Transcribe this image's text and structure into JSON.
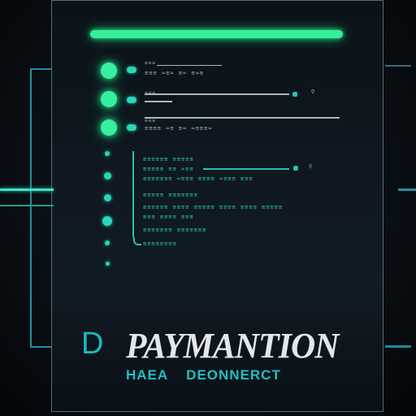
{
  "screen": {
    "title_prefix": "D",
    "title": "PAYMANTION",
    "subtitle_left": "HAEA",
    "subtitle_right": "DEONNERCT"
  },
  "colors": {
    "accent_green": "#35ef9a",
    "accent_teal": "#2bbfb0",
    "title_text": "#e3e7e9",
    "subtitle_text": "#1fc0c4",
    "background": "#0a1116"
  },
  "rows": {
    "row1": {
      "text_a": "≡≡≡ ≈≡≈ ≡≈ ≡≈≡",
      "text_b": "≡≡≡"
    },
    "row2": {
      "text_a": "≡≡≡",
      "marker": "ǫ"
    },
    "row3": {
      "text_a": "≡≡≡≡ ≈≡ ≡≈ ≈≡≡≡≈",
      "text_b": "≡≡≡"
    }
  },
  "log": {
    "lines": [
      "≡≡≡≡≡≡  ≡≡≡≡≡",
      "≡≡≡≡≡ ≡≡ ≈≡≡",
      "≡≡≡≡≡≡≡ ≈≡≡≡ ≡≡≡≡ ≈≡≡≡ ≡≡≡",
      "≡≡≡≡≡ ≡≡≡≡≡≡≡",
      "≡≡≡≡≡≡ ≡≡≡≡ ≡≡≡≡≡ ≡≡≡≡ ≡≡≡≡ ≡≡≡≡≡",
      "≡≡≡ ≡≡≡≡ ≡≡≡",
      "≡≡≡≡≡≡≡ ≡≡≡≡≡≡≡",
      "≡≡≡≡≡≡≡≡"
    ]
  }
}
